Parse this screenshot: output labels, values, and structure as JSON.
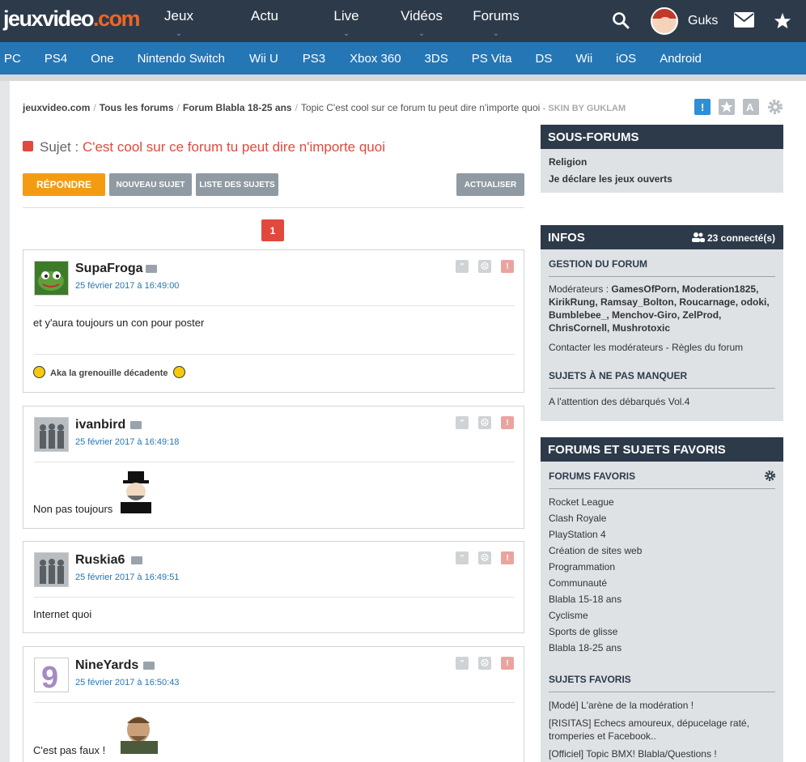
{
  "header": {
    "logo_main": "jeuxvideo",
    "logo_dot": ".com",
    "nav": [
      "Jeux",
      "Actu",
      "Live",
      "Vidéos",
      "Forums"
    ],
    "username": "Guks"
  },
  "platforms": [
    "PC",
    "PS4",
    "One",
    "Nintendo Switch",
    "Wii U",
    "PS3",
    "Xbox 360",
    "3DS",
    "PS Vita",
    "DS",
    "Wii",
    "iOS",
    "Android"
  ],
  "breadcrumb": {
    "items": [
      "jeuxvideo.com",
      "Tous les forums",
      "Forum Blabla 18-25 ans",
      "Topic C'est cool sur ce forum tu peut dire n'importe quoi"
    ],
    "skin": "- SKIN BY GUKLAM"
  },
  "subject": {
    "label": "Sujet :",
    "title": "C'est cool sur ce forum tu peut dire n'importe quoi"
  },
  "buttons": {
    "reply": "RÉPONDRE",
    "new_topic": "NOUVEAU SUJET",
    "topic_list": "LISTE DES SUJETS",
    "refresh": "ACTUALISER"
  },
  "pagination": {
    "current": "1"
  },
  "posts": [
    {
      "author": "SupaFroga",
      "date": "25 février 2017 à 16:49:00",
      "message": "et y'aura toujours un con pour poster",
      "signature": "Aka la grenouille décadente"
    },
    {
      "author": "ivanbird",
      "date": "25 février 2017 à 16:49:18",
      "message": "Non pas toujours"
    },
    {
      "author": "Ruskia6",
      "date": "25 février 2017 à 16:49:51",
      "message": "Internet quoi"
    },
    {
      "author": "NineYards",
      "date": "25 février 2017 à 16:50:43",
      "message": "C'est pas faux !"
    }
  ],
  "sidebar": {
    "subforums": {
      "title": "SOUS-FORUMS",
      "items": [
        "Religion",
        "Je déclare les jeux ouverts"
      ]
    },
    "infos": {
      "title": "INFOS",
      "connected": "23 connecté(s)",
      "management_title": "GESTION DU FORUM",
      "moderators_label": "Modérateurs :",
      "moderators": "GamesOfPorn, Moderation1825, KirikRung, Ramsay_Bolton, Roucarnage, odoki, Bumblebee_, Menchov-Giro, ZelProd, ChrisCornell, Mushrotoxic",
      "contact": "Contacter les modérateurs",
      "rules": "Règles du forum",
      "dont_miss_title": "SUJETS À NE PAS MANQUER",
      "dont_miss_items": [
        "A l'attention des débarqués Vol.4"
      ]
    },
    "favorites": {
      "title": "FORUMS ET SUJETS FAVORIS",
      "forums_title": "FORUMS FAVORIS",
      "forums": [
        "Rocket League",
        "Clash Royale",
        "PlayStation 4",
        "Création de sites web",
        "Programmation",
        "Communauté",
        "Blabla 15-18 ans",
        "Cyclisme",
        "Sports de glisse",
        "Blabla 18-25 ans"
      ],
      "topics_title": "SUJETS FAVORIS",
      "topics": [
        "[Modé] L'arène de la modération !",
        "[RISITAS] Echecs amoureux, dépucelage raté, tromperies et Facebook..",
        "[Officiel] Topic BMX! Blabla/Questions !"
      ]
    }
  },
  "colors": {
    "header_bg": "#2d3a4a",
    "platform_bg": "#2576b5",
    "accent_red": "#e0493c",
    "reply_orange": "#f39c12"
  }
}
